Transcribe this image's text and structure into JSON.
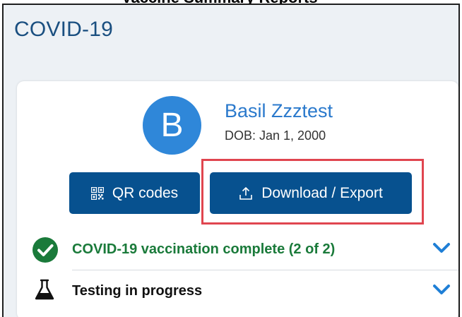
{
  "top_cut_text": "Vaccine Summary Reports",
  "panel": {
    "title": "COVID-19"
  },
  "patient": {
    "initial": "B",
    "name": "Basil Zzztest",
    "dob": "DOB: Jan 1, 2000"
  },
  "actions": {
    "qr_label": "QR codes",
    "download_label": "Download / Export"
  },
  "status": {
    "vaccination": "COVID-19 vaccination complete (2 of 2)",
    "testing": "Testing in progress"
  },
  "colors": {
    "panel_bg": "#edf1f5",
    "title": "#1a4f80",
    "avatar": "#2f87d9",
    "name": "#2a79cc",
    "button": "#07518f",
    "success": "#1a7a3a",
    "chevron": "#1f7fd6",
    "highlight": "#e0454f"
  },
  "icons": {
    "qr": "qr-code-icon",
    "download": "upload-arrow-icon",
    "vaccination": "check-circle-icon",
    "testing": "flask-icon",
    "expand": "chevron-down-icon"
  }
}
